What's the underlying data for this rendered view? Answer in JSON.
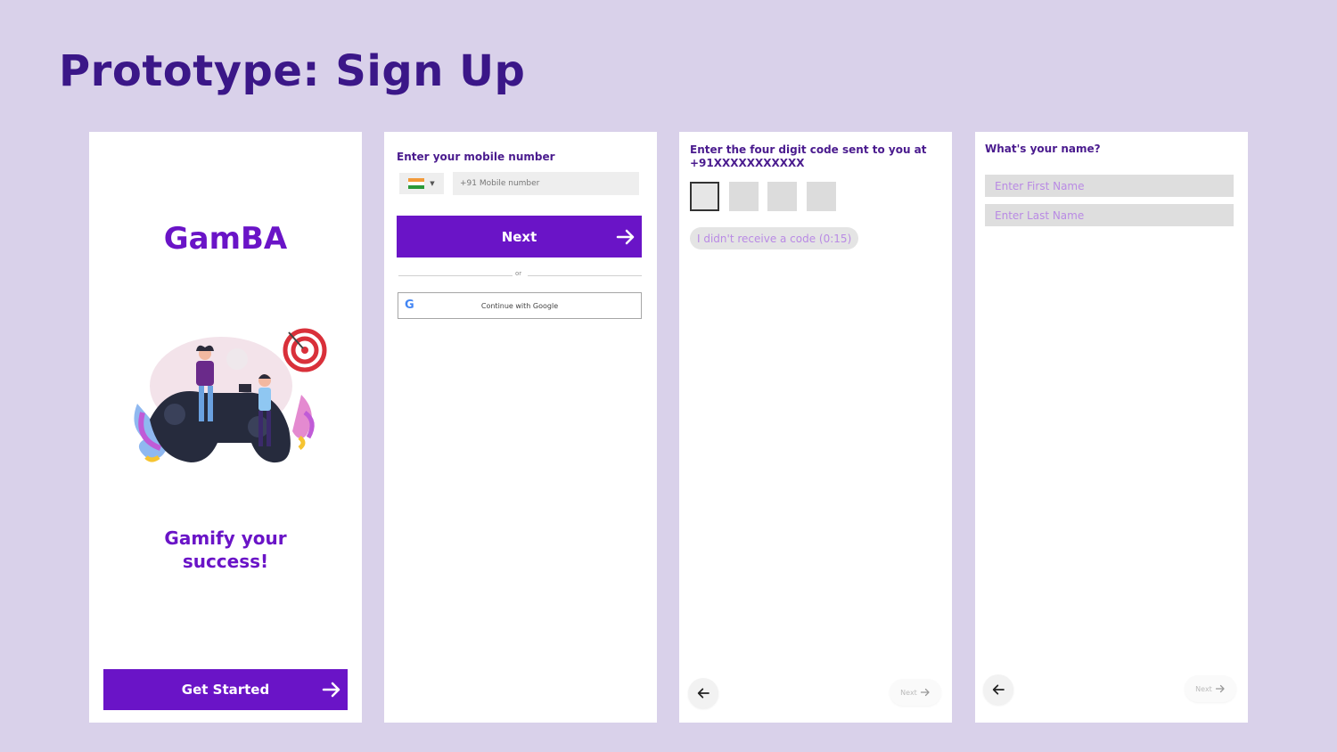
{
  "slide": {
    "title": "Prototype: Sign Up"
  },
  "screen1": {
    "brand": "GamBA",
    "tagline_line1": "Gamify your",
    "tagline_line2": "success!",
    "cta_label": "Get Started",
    "cta_icon": "arrow-right-icon"
  },
  "screen2": {
    "prompt": "Enter your mobile number",
    "country_flag": "india-flag-icon",
    "phone_placeholder": "+91 Mobile number",
    "next_label": "Next",
    "divider_text": "or",
    "google_label": "Continue with Google",
    "google_icon": "google-g-icon"
  },
  "screen3": {
    "prompt": "Enter the four digit code sent to you at",
    "phone": "+91XXXXXXXXXXX",
    "resend_label": "I didn't receive a code (0:15)",
    "next_label": "Next"
  },
  "screen4": {
    "prompt": "What's your name?",
    "first_name_placeholder": "Enter First Name",
    "last_name_placeholder": "Enter Last Name",
    "next_label": "Next"
  },
  "colors": {
    "background": "#d9d1ea",
    "title": "#3b1788",
    "accent": "#6a14c7",
    "placeholder": "#b98ae4"
  }
}
